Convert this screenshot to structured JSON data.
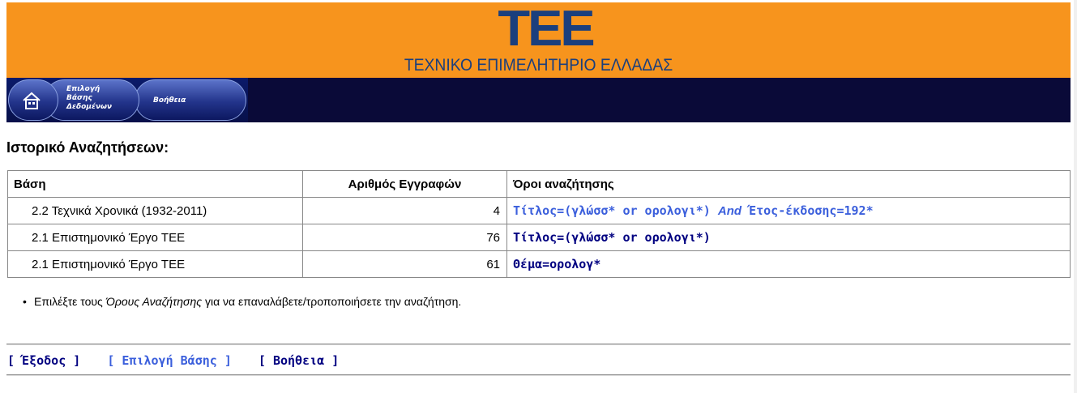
{
  "header": {
    "logo_text": "ΤΕΕ",
    "org_name": "ΤΕΧΝΙΚΟ ΕΠΙΜΕΛΗΤΗΡΙΟ ΕΛΛΑΔΑΣ",
    "colors": {
      "banner": "#f7941d",
      "logo": "#1b3f7d",
      "navbar": "#0a0a38"
    }
  },
  "nav": {
    "home_icon": "home-icon",
    "select_db_label": "Επιλογή\nΒάσης\nΔεδομένων",
    "help_label": "Βοήθεια"
  },
  "page": {
    "title": "Ιστορικό Αναζητήσεων:"
  },
  "table": {
    "headers": [
      "Βάση",
      "Αριθμός Εγγραφών",
      "Όροι αναζήτησης"
    ],
    "rows": [
      {
        "db": "2.2 Τεχνικά Χρονικά (1932-2011)",
        "count": "4",
        "term_a": "Τίτλος=(γλώσσ* or ορολογι*)",
        "operator": "And",
        "term_b": "Έτος-έκδοσης=192*"
      },
      {
        "db": "2.1 Επιστημονικό Έργο ΤΕΕ",
        "count": "76",
        "term": "Τίτλος=(γλώσσ* or ορολογι*)"
      },
      {
        "db": "2.1 Επιστημονικό Έργο ΤΕΕ",
        "count": "61",
        "term": "Θέμα=ορολογ*"
      }
    ]
  },
  "hint": {
    "before": "Επιλέξτε τους ",
    "emph": "Όρους Αναζήτησης",
    "after": " για να επαναλάβετε/τροποποιήσετε την αναζήτηση."
  },
  "footer": {
    "exit": "[ Έξοδος ]",
    "select_db": "[ Επιλογή Βάσης ]",
    "help": "[ Βοήθεια ]"
  }
}
